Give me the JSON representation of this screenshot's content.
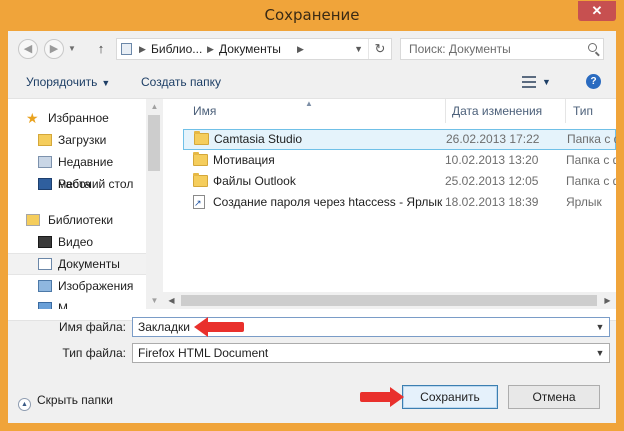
{
  "window": {
    "title": "Сохранение",
    "close_glyph": "✕"
  },
  "address": {
    "segments": [
      "Библио...",
      "Документы"
    ],
    "refresh_glyph": "↻"
  },
  "search": {
    "placeholder": "Поиск: Документы"
  },
  "toolbar": {
    "organize_label": "Упорядочить",
    "new_folder_label": "Создать папку",
    "help_glyph": "?"
  },
  "nav": {
    "items": [
      {
        "label": "Избранное",
        "icon": "star-icon"
      },
      {
        "label": "Загрузки",
        "icon": "downloads-icon"
      },
      {
        "label": "Недавние места",
        "icon": "recent-places-icon"
      },
      {
        "label": "Рабочий стол",
        "icon": "desktop-icon"
      },
      {
        "label": "Библиотеки",
        "icon": "libraries-icon"
      },
      {
        "label": "Видео",
        "icon": "video-icon"
      },
      {
        "label": "Документы",
        "icon": "documents-icon"
      },
      {
        "label": "Изображения",
        "icon": "images-icon"
      },
      {
        "label": "М",
        "icon": "music-icon"
      }
    ]
  },
  "files": {
    "columns": {
      "name": "Имя",
      "date": "Дата изменения",
      "type": "Тип"
    },
    "rows": [
      {
        "name": "Camtasia Studio",
        "date": "26.02.2013 17:22",
        "type": "Папка с ф",
        "icon": "folder-icon"
      },
      {
        "name": "Мотивация",
        "date": "10.02.2013 13:20",
        "type": "Папка с ф",
        "icon": "folder-icon"
      },
      {
        "name": "Файлы Outlook",
        "date": "25.02.2013 12:05",
        "type": "Папка с ф",
        "icon": "folder-icon"
      },
      {
        "name": "Создание пароля через htaccess - Ярлык",
        "date": "18.02.2013 18:39",
        "type": "Ярлык",
        "icon": "shortcut-icon"
      }
    ]
  },
  "form": {
    "filename_label": "Имя файла:",
    "filename_value": "Закладки",
    "filetype_label": "Тип файла:",
    "filetype_value": "Firefox HTML Document"
  },
  "footer": {
    "hide_folders_label": "Скрыть папки",
    "save_label": "Сохранить",
    "cancel_label": "Отмена"
  },
  "colors": {
    "frame": "#f0a43a",
    "close": "#c75050",
    "selection": "#e5f3fb",
    "pointer_arrow": "#e9302c"
  }
}
